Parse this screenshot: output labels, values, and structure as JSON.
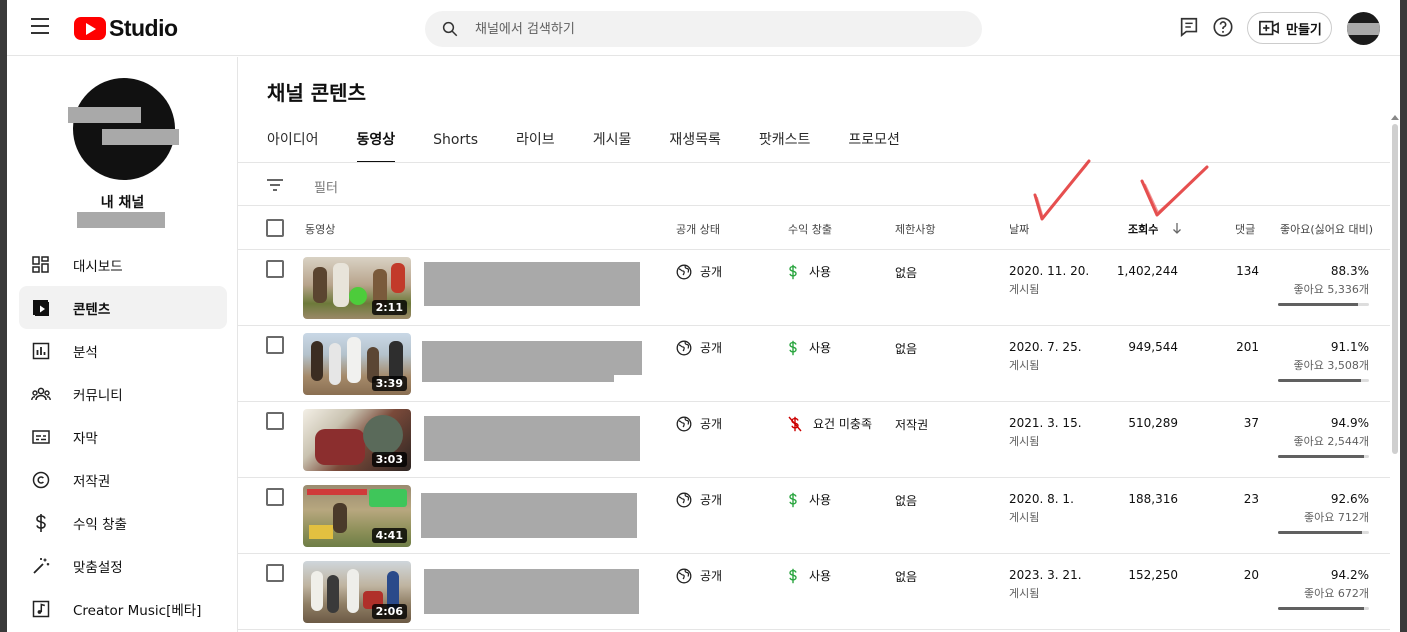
{
  "app": {
    "logo_text": "Studio",
    "search_placeholder": "채널에서 검색하기",
    "create_label": "만들기"
  },
  "channel": {
    "name": "내 채널"
  },
  "sidebar": {
    "items": [
      {
        "label": "대시보드",
        "icon": "dashboard-icon"
      },
      {
        "label": "콘텐츠",
        "icon": "content-icon",
        "active": true
      },
      {
        "label": "분석",
        "icon": "analytics-icon"
      },
      {
        "label": "커뮤니티",
        "icon": "community-icon"
      },
      {
        "label": "자막",
        "icon": "subtitles-icon"
      },
      {
        "label": "저작권",
        "icon": "copyright-icon"
      },
      {
        "label": "수익 창출",
        "icon": "dollar-icon"
      },
      {
        "label": "맞춤설정",
        "icon": "magic-wand-icon"
      },
      {
        "label": "Creator Music[베타]",
        "icon": "music-icon"
      }
    ]
  },
  "main": {
    "title": "채널 콘텐츠",
    "tabs": [
      {
        "label": "아이디어"
      },
      {
        "label": "동영상",
        "active": true
      },
      {
        "label": "Shorts"
      },
      {
        "label": "라이브"
      },
      {
        "label": "게시물"
      },
      {
        "label": "재생목록"
      },
      {
        "label": "팟캐스트"
      },
      {
        "label": "프로모션"
      }
    ],
    "filter_label": "필터",
    "columns": {
      "video": "동영상",
      "visibility": "공개 상태",
      "monetization": "수익 창출",
      "restrictions": "제한사항",
      "date": "날짜",
      "views": "조회수",
      "comments": "댓글",
      "likes": "좋아요(싫어요 대비)"
    },
    "rows": [
      {
        "duration": "2:11",
        "visibility": "공개",
        "monetization": "사용",
        "monetization_status": "on",
        "restrictions": "없음",
        "date": "2020. 11. 20.",
        "date_status": "게시됨",
        "views": "1,402,244",
        "comments": "134",
        "likes_pct": "88.3%",
        "likes_count": "좋아요 5,336개",
        "likes_ratio": 0.883
      },
      {
        "duration": "3:39",
        "visibility": "공개",
        "monetization": "사용",
        "monetization_status": "on",
        "restrictions": "없음",
        "date": "2020. 7. 25.",
        "date_status": "게시됨",
        "views": "949,544",
        "comments": "201",
        "likes_pct": "91.1%",
        "likes_count": "좋아요 3,508개",
        "likes_ratio": 0.911
      },
      {
        "duration": "3:03",
        "visibility": "공개",
        "monetization": "요건 미충족",
        "monetization_status": "off",
        "restrictions": "저작권",
        "date": "2021. 3. 15.",
        "date_status": "게시됨",
        "views": "510,289",
        "comments": "37",
        "likes_pct": "94.9%",
        "likes_count": "좋아요 2,544개",
        "likes_ratio": 0.949
      },
      {
        "duration": "4:41",
        "visibility": "공개",
        "monetization": "사용",
        "monetization_status": "on",
        "restrictions": "없음",
        "date": "2020. 8. 1.",
        "date_status": "게시됨",
        "views": "188,316",
        "comments": "23",
        "likes_pct": "92.6%",
        "likes_count": "좋아요 712개",
        "likes_ratio": 0.926
      },
      {
        "duration": "2:06",
        "visibility": "공개",
        "monetization": "사용",
        "monetization_status": "on",
        "restrictions": "없음",
        "date": "2023. 3. 21.",
        "date_status": "게시됨",
        "views": "152,250",
        "comments": "20",
        "likes_pct": "94.2%",
        "likes_count": "좋아요 672개",
        "likes_ratio": 0.942
      }
    ]
  },
  "colors": {
    "brand_red": "#ff0000",
    "monetization_green": "#2ba640",
    "monetization_off_red": "#cc0000",
    "annotation_red": "#e03030"
  }
}
